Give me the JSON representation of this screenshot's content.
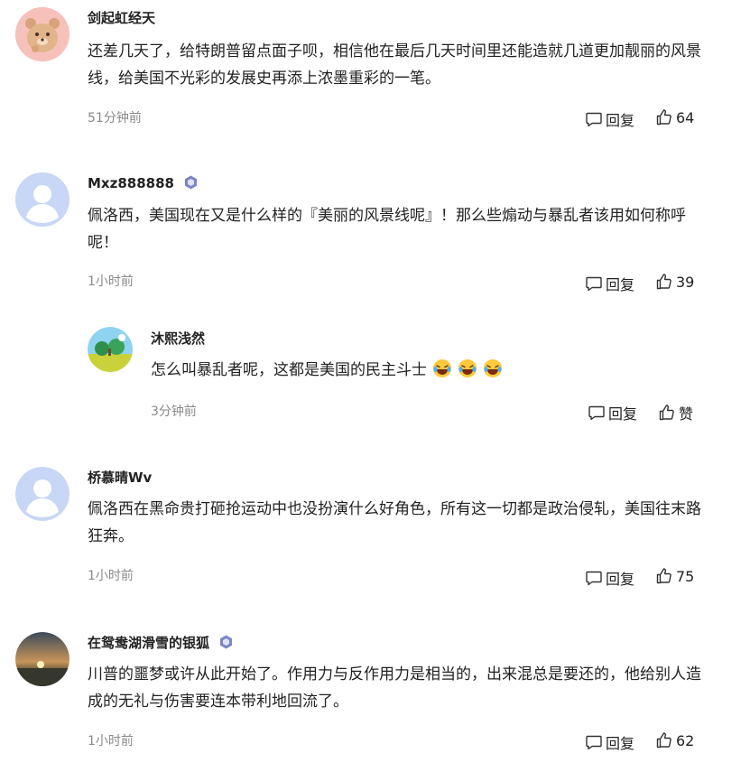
{
  "comments": [
    {
      "user": "剑起虹经天",
      "text": "还差几天了，给特朗普留点面子呗，相信他在最后几天时间里还能造就几道更加靓丽的风景线，给美国不光彩的发展史再添上浓墨重彩的一笔。",
      "time": "51分钟前",
      "reply_label": "回复",
      "likes": "64",
      "avatar": "bear-avatar"
    },
    {
      "user": "Mxz888888",
      "text": "佩洛西，美国现在又是什么样的『美丽的风景线呢』！那么些煽动与暴乱者该用如何称呼呢！",
      "time": "1小时前",
      "reply_label": "回复",
      "likes": "39",
      "avatar": "default-avatar",
      "verified": true
    },
    {
      "user": "沐熙浅然",
      "text": "怎么叫暴乱者呢，这都是美国的民主斗士",
      "time": "3分钟前",
      "reply_label": "回复",
      "likes": "赞",
      "avatar": "landscape-avatar",
      "emoji": "laugh-cry-emoji"
    },
    {
      "user": "桥慕晴Wv",
      "text": "佩洛西在黑命贵打砸抢运动中也没扮演什么好角色，所有这一切都是政治侵轧，美国往末路狂奔。",
      "time": "1小时前",
      "reply_label": "回复",
      "likes": "75",
      "avatar": "default-avatar"
    },
    {
      "user": "在鸳鸯湖滑雪的银狐",
      "text": "川普的噩梦或许从此开始了。作用力与反作用力是相当的，出来混总是要还的，他给别人造成的无礼与伤害要连本带利地回流了。",
      "time": "1小时前",
      "reply_label": "回复",
      "likes": "62",
      "avatar": "sunset-avatar",
      "verified": true
    }
  ],
  "colors": {
    "time": "#8a8a8a",
    "badge": "#7b86c6",
    "default_avatar": "#c9d9f6"
  }
}
